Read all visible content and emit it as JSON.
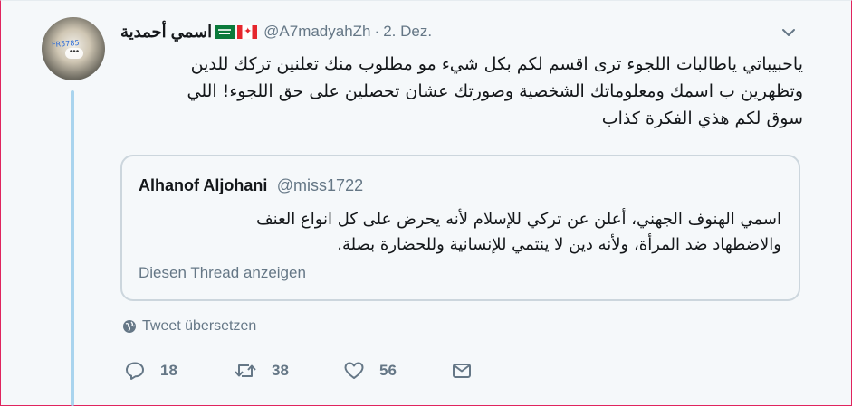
{
  "tweet": {
    "display_name": "اسمي أحمدية",
    "handle": "@A7madyahZh",
    "separator": "·",
    "date": "2. Dez.",
    "avatar_tag": "FR5785",
    "text_lines": [
      "ياحبيباتي ياطالبات اللجوء ترى اقسم لكم بكل شيء مو مطلوب منك تعلنين تركك للدين",
      "وتظهرين ب اسمك ومعلوماتك الشخصية وصورتك عشان تحصلين على حق اللجوء! اللي",
      "سوق لكم هذي الفكرة كذاب"
    ]
  },
  "quote": {
    "name": "Alhanof Aljohani",
    "handle": "@miss1722",
    "text_lines": [
      "اسمي الهنوف الجهني، أعلن عن تركي للإسلام لأنه يحرض على كل انواع العنف",
      "والاضطهاد ضد المرأة، ولأنه دين لا ينتمي للإنسانية وللحضارة بصلة."
    ],
    "thread_link": "Diesen Thread anzeigen"
  },
  "translate_label": "Tweet übersetzen",
  "actions": {
    "reply_count": "18",
    "retweet_count": "38",
    "like_count": "56"
  },
  "icons": [
    "globe-icon",
    "reply-icon",
    "retweet-icon",
    "like-icon",
    "message-icon",
    "chevron-down-icon",
    "saudi-flag-icon",
    "canada-flag-icon"
  ],
  "colors": {
    "text": "#14171a",
    "muted": "#657786",
    "thread_line": "#a9d4ee",
    "border": "#ccd6dd",
    "background": "#f5f8fa"
  }
}
